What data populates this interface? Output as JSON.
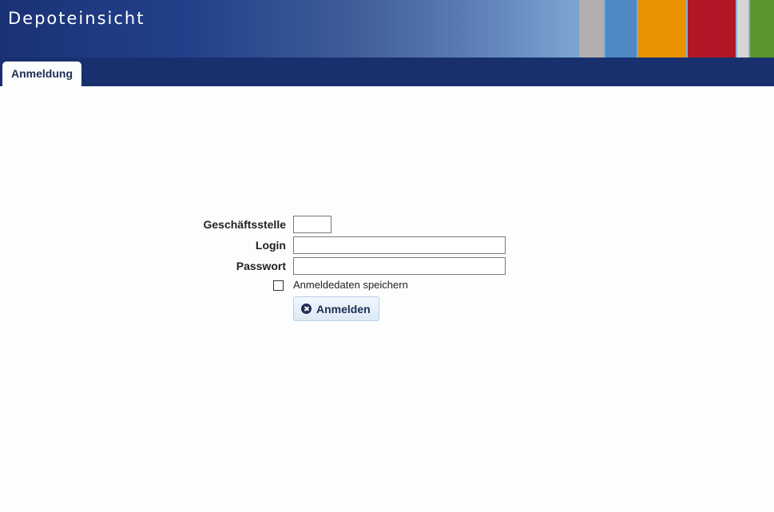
{
  "header": {
    "title": "Depoteinsicht",
    "stripe_colors": [
      "#b3afae",
      "#4e88c5",
      "#e99200",
      "#b01626",
      "#d8d3d4",
      "#5a972c"
    ]
  },
  "tabs": [
    {
      "label": "Anmeldung",
      "active": true
    }
  ],
  "form": {
    "branch_label": "Geschäftsstelle",
    "branch_value": "",
    "login_label": "Login",
    "login_value": "",
    "password_label": "Passwort",
    "password_value": "",
    "remember_label": "Anmeldedaten speichern",
    "remember_checked": false,
    "submit_label": "Anmelden",
    "submit_icon": "close-circle-icon"
  }
}
